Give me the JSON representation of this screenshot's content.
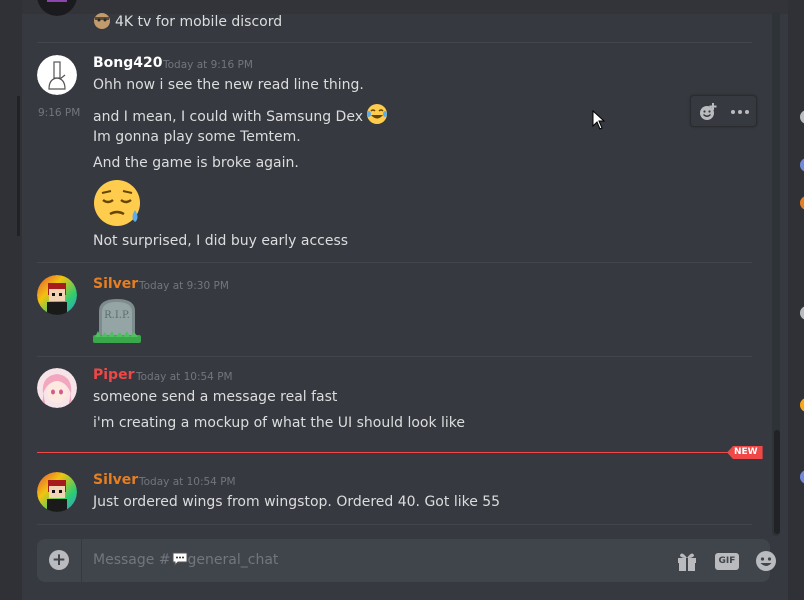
{
  "colors": {
    "background": "#36393f",
    "accent_new": "#f04747",
    "author_bong": "#ffffff",
    "author_silver": "#e67e22",
    "author_piper": "#f04747"
  },
  "previous_message": {
    "text": "4K tv for mobile discord",
    "emoji": "face-emoji"
  },
  "groups": [
    {
      "author": "Bong420",
      "timestamp": "Today at 9:16 PM",
      "side_timestamp": "9:16 PM",
      "avatar": "bong-avatar",
      "lines": [
        "Ohh now i see the new read line thing.",
        "and I mean, I could with Samsung Dex",
        "Im gonna play some Temtem.",
        "And the game is broke again.",
        "Not surprised, I did buy early access"
      ],
      "inline_emoji": "joy-emoji",
      "big_emoji": "disappointed-relieved-emoji"
    },
    {
      "author": "Silver",
      "timestamp": "Today at 9:30 PM",
      "avatar": "silver-avatar",
      "big_emoji": "headstone-rip-emoji",
      "headstone_text": "R.I.P."
    },
    {
      "author": "Piper",
      "timestamp": "Today at 10:54 PM",
      "avatar": "piper-avatar",
      "lines": [
        "someone send a message real fast",
        "i'm creating a mockup of what the UI should look like"
      ]
    },
    {
      "author": "Silver",
      "timestamp": "Today at 10:54 PM",
      "avatar": "silver-avatar",
      "lines": [
        "Just ordered wings from wingstop. Ordered 40. Got like 55"
      ]
    }
  ],
  "new_divider": {
    "label": "NEW"
  },
  "hover_toolbar": {
    "icons": [
      "add-reaction-icon",
      "more-icon"
    ]
  },
  "composer": {
    "placeholder_prefix": "Message #",
    "channel_name": "general_chat",
    "channel_icon": "speech-bubble-icon",
    "gif_label": "GIF",
    "icons": [
      "plus-icon",
      "gift-icon",
      "gif-icon",
      "emoji-icon"
    ]
  }
}
